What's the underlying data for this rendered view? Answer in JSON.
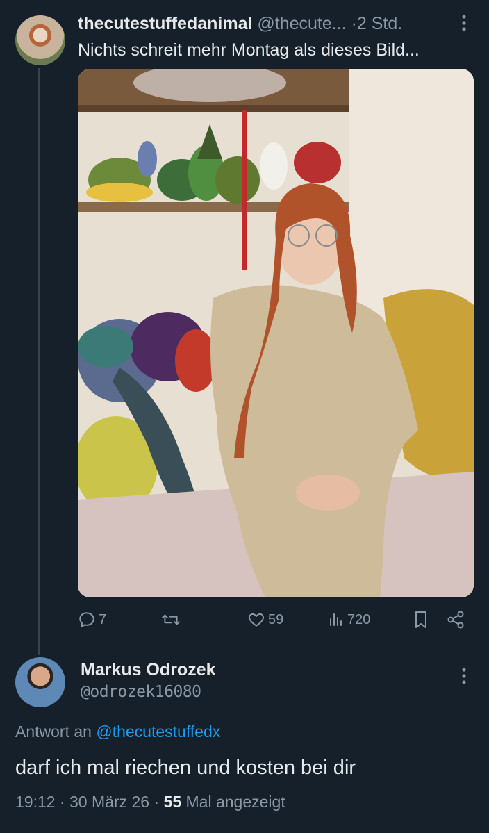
{
  "tweet": {
    "display_name": "thecutestuffedanimal",
    "handle": "@thecute...",
    "separator": "·",
    "time": "2 Std.",
    "text": "Nichts schreit mehr Montag als dieses Bild...",
    "more_icon": "more-vertical-icon",
    "actions": {
      "reply_count": "7",
      "retweet_count": "",
      "like_count": "59",
      "views_count": "720"
    }
  },
  "reply": {
    "display_name": "Markus Odrozek",
    "handle": "@odrozek16080",
    "reply_to_prefix": "Antwort an",
    "reply_to_mention": "@thecutestuffedx",
    "text": "darf ich mal riechen und kosten bei dir",
    "time": "19:12",
    "date": "30 März 26",
    "views": "55",
    "views_suffix": "Mal angezeigt"
  },
  "colors": {
    "background": "#15202b",
    "text_primary": "#e7e9ea",
    "text_secondary": "#8b98a5",
    "link": "#1d9bf0",
    "thread_line": "#38444d"
  }
}
